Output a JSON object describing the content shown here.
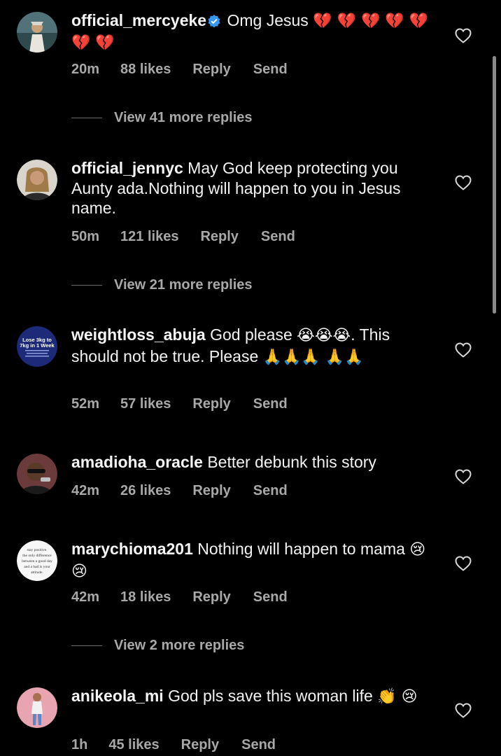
{
  "comments": [
    {
      "username": "official_mercyeke",
      "verified": true,
      "text": "Omg Jesus",
      "emoji": "💔 💔 💔 💔 💔 💔 💔",
      "time": "20m",
      "likes": "88 likes",
      "reply": "Reply",
      "send": "Send",
      "more_replies": "View 41 more replies"
    },
    {
      "username": "official_jennyc",
      "verified": false,
      "text": "May God keep protecting you Aunty ada.Nothing will happen to you in Jesus name.",
      "time": "50m",
      "likes": "121 likes",
      "reply": "Reply",
      "send": "Send",
      "more_replies": "View 21 more replies"
    },
    {
      "username": "weightloss_abuja",
      "verified": false,
      "text_before": "God please",
      "emoji_a": "😭😭😭",
      "text_mid": ". This should not be true. Please",
      "emoji_b": "🙏🙏🙏 🙏🙏",
      "avatar_text_1": "Lose 3kg to",
      "avatar_text_2": "7kg in 1 Week",
      "time": "52m",
      "likes": "57 likes",
      "reply": "Reply",
      "send": "Send"
    },
    {
      "username": "amadioha_oracle",
      "verified": false,
      "text": "Better debunk this story",
      "time": "42m",
      "likes": "26 likes",
      "reply": "Reply",
      "send": "Send"
    },
    {
      "username": "marychioma201",
      "verified": false,
      "text": "Nothing will happen to mama",
      "emoji": "😢 😢",
      "avatar_lines": [
        "stay positive.",
        "the only difference",
        "between a good day",
        "and a bad is your",
        "attitude."
      ],
      "time": "42m",
      "likes": "18 likes",
      "reply": "Reply",
      "send": "Send",
      "more_replies": "View 2 more replies"
    },
    {
      "username": "anikeola_mi",
      "verified": false,
      "text": "God pls save this woman life",
      "emoji": "👏 😢",
      "time": "1h",
      "likes": "45 likes",
      "reply": "Reply",
      "send": "Send"
    }
  ],
  "colors": {
    "background": "#000000",
    "text": "#f2f2f2",
    "muted": "#a8a8a8",
    "verified_blue": "#3897f0"
  }
}
